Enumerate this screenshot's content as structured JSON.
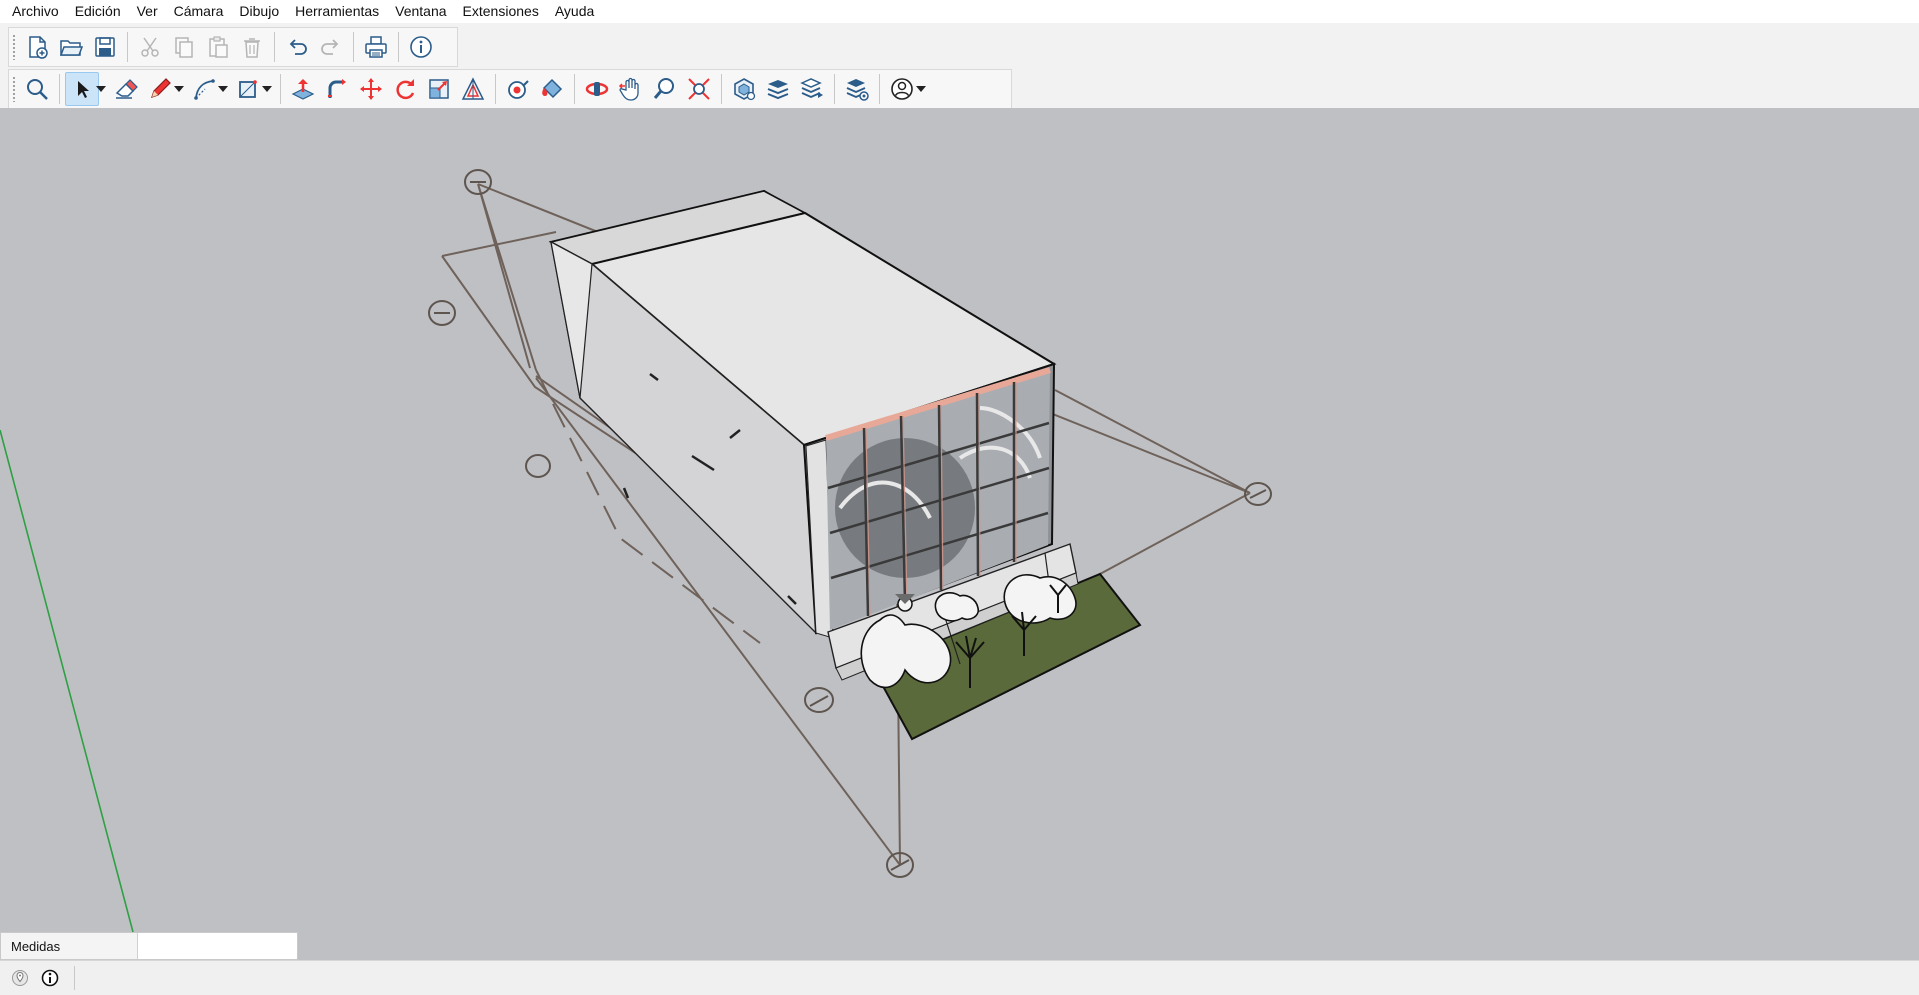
{
  "menu": [
    {
      "label": "Archivo"
    },
    {
      "label": "Edición"
    },
    {
      "label": "Ver"
    },
    {
      "label": "Cámara"
    },
    {
      "label": "Dibujo"
    },
    {
      "label": "Herramientas"
    },
    {
      "label": "Ventana"
    },
    {
      "label": "Extensiones"
    },
    {
      "label": "Ayuda"
    }
  ],
  "toolbar_standard": {
    "icons": [
      "new-file-icon",
      "open-folder-icon",
      "save-icon",
      "cut-icon",
      "copy-icon",
      "paste-icon",
      "delete-icon",
      "undo-icon",
      "redo-icon",
      "print-icon",
      "model-info-icon"
    ]
  },
  "toolbar_main": {
    "active_tool": "select",
    "icons": [
      "search-icon",
      "select-arrow-icon",
      "eraser-icon",
      "pencil-line-icon",
      "arc-icon",
      "rectangle-icon",
      "push-pull-icon",
      "follow-me-icon",
      "move-icon",
      "rotate-icon",
      "scale-icon",
      "offset-icon",
      "tape-measure-icon",
      "paint-bucket-icon",
      "orbit-icon",
      "pan-icon",
      "zoom-icon",
      "zoom-extents-icon",
      "components-icon",
      "layers-icon",
      "styles-icon",
      "scenes-icon",
      "account-icon"
    ]
  },
  "measurements": {
    "label": "Medidas",
    "value": ""
  },
  "status": {
    "icons": [
      "geolocation-icon",
      "info-credits-icon"
    ]
  },
  "colors": {
    "viewport_bg": "#bfc0c4",
    "toolbar_bg": "#f2f2f2",
    "active_tool_bg": "#cce4f7",
    "green_axis": "#2ea043",
    "section_plane": "#6e625a",
    "grass": "#5a6a3a",
    "window_frame": "#e8a898"
  }
}
